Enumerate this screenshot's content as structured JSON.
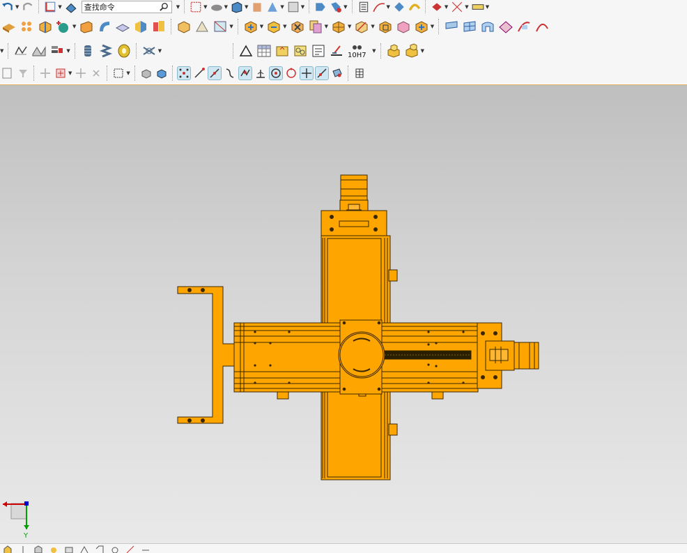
{
  "app": {
    "window": "3D CAD modeling workspace"
  },
  "toolbar": {
    "search": {
      "value": "查找命令",
      "placeholder": "查找命令"
    },
    "fit_tolerance_label": "10H7"
  },
  "viewport": {
    "background_top": "#bfbfbf",
    "background_bottom": "#e9e9e9",
    "model_color": "#ffa500",
    "model_edge_color": "#3a2600",
    "triad": {
      "y_axis_label": "Y",
      "x_axis_color": "#cc0000",
      "y_axis_color": "#00a000",
      "z_axis_color": "#0000cc"
    }
  },
  "icons": {
    "row1": [
      "undo-icon",
      "redo-icon",
      "coordinate-system-icon",
      "sketch-plane-icon",
      "search-icon",
      "zoom-fit-icon",
      "surface-icon",
      "box-icon",
      "cylinder-icon",
      "cone-icon",
      "blend-icon",
      "extrude-icon",
      "revolve-icon",
      "list-icon",
      "curve-icon",
      "rotate-view-icon",
      "sweep-icon",
      "cylinder-view-icon",
      "ruler-icon"
    ],
    "row2": [
      "pattern-icon",
      "array-icon",
      "split-part-icon",
      "add-feature-icon",
      "section-box-icon",
      "twist-icon",
      "face-blend-icon",
      "colored-box-icon",
      "stack-icon",
      "shell-icon",
      "fold-icon",
      "unfold-icon",
      "boolean-add-icon",
      "boolean-subtract-icon",
      "boolean-intersect-icon",
      "copy-face-icon",
      "grid-box-icon",
      "transform-icon",
      "replace-face-icon",
      "mirror-body-icon",
      "move-face-icon",
      "sheet-metal-icon",
      "bend-icon",
      "flange-icon",
      "hem-icon",
      "corner-icon",
      "wrap-icon"
    ],
    "row3": [
      "draft-icon",
      "rib-icon",
      "edit-icon",
      "thread-icon",
      "spring-icon",
      "washer-icon",
      "wire-icon",
      "triangle-icon",
      "table-icon",
      "datum-icon",
      "feature-frame-icon",
      "note-icon",
      "surface-finish-icon",
      "fit-tolerance-icon",
      "part-list-icon",
      "assembly-icon"
    ],
    "row4": [
      "select-icon",
      "filter-icon",
      "snap-icon",
      "snap-grid-icon",
      "box-select-icon",
      "solid-icon",
      "shaded-icon",
      "snap-point-icon",
      "snap-endpoint-icon",
      "snap-midpoint-icon",
      "snap-curve-icon",
      "snap-intersection-icon",
      "snap-perpendicular-icon",
      "snap-center-icon",
      "snap-quadrant-icon",
      "snap-existing-icon",
      "snap-tangent-icon",
      "snap-on-face-icon",
      "table-grid-icon"
    ],
    "status": [
      "home-icon",
      "view-icon",
      "cube-icon",
      "light-icon",
      "render-icon",
      "layer-icon",
      "tag-icon",
      "measure-icon",
      "axis-icon",
      "dimension-icon"
    ]
  }
}
